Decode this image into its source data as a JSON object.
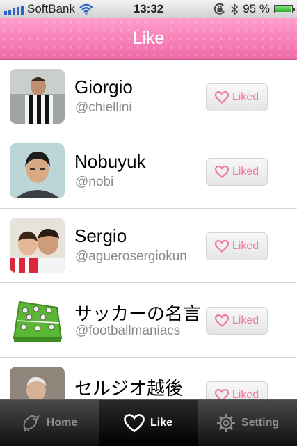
{
  "statusbar": {
    "carrier": "SoftBank",
    "time": "13:32",
    "battery": "95 %",
    "battery_level": 0.95
  },
  "navbar": {
    "title": "Like"
  },
  "likes": [
    {
      "name": "Giorgio",
      "handle": "@chiellini",
      "button": "Liked"
    },
    {
      "name": "Nobuyuk",
      "handle": "@nobi",
      "button": "Liked"
    },
    {
      "name": "Sergio",
      "handle": "@aguerosergiokun",
      "button": "Liked"
    },
    {
      "name": "サッカーの名言",
      "handle": "@footballmaniacs",
      "button": "Liked"
    },
    {
      "name": "セルジオ越後",
      "handle": "",
      "button": "Liked"
    }
  ],
  "tabbar": {
    "home": "Home",
    "like": "Like",
    "setting": "Setting"
  },
  "colors": {
    "accent_pink": "#f57cb4",
    "liked_pink": "#ef7aa9"
  }
}
